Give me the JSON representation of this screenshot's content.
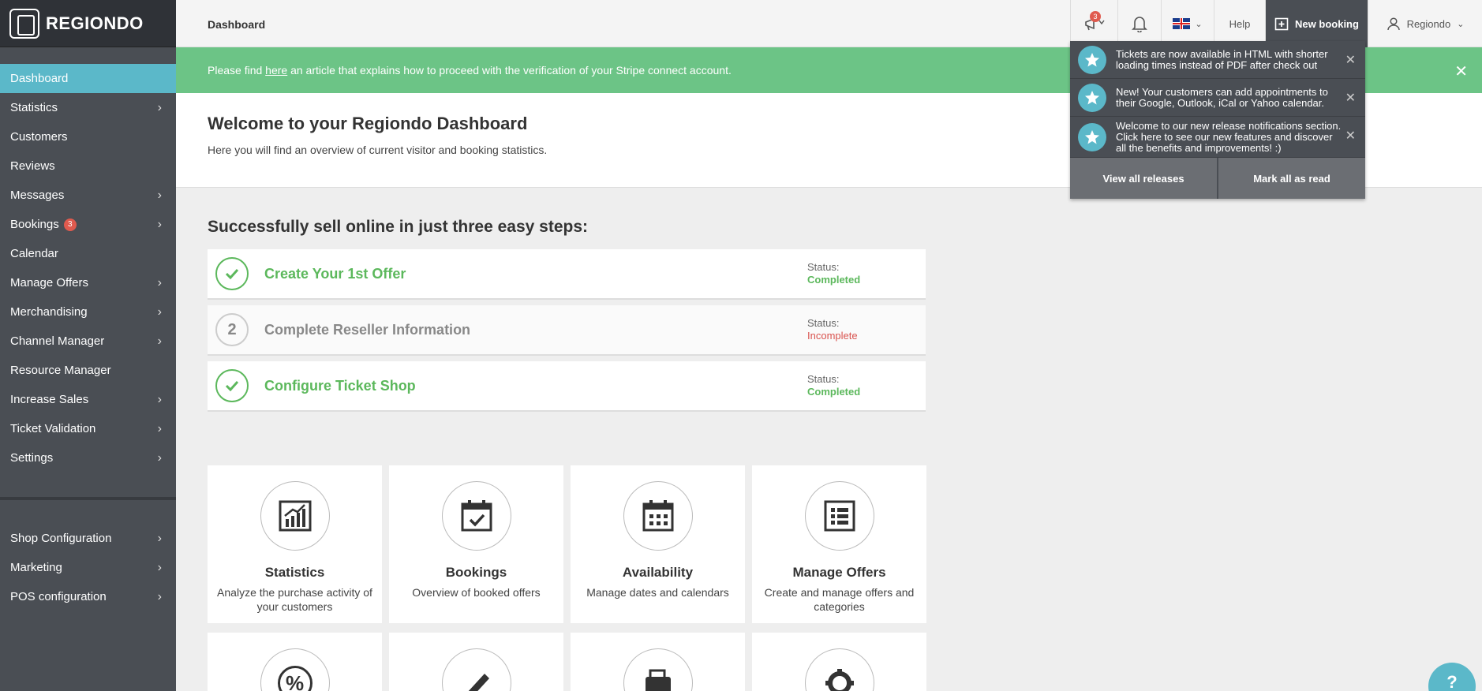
{
  "brand": {
    "name": "REGIONDO"
  },
  "sidebar": {
    "items": [
      {
        "label": "Dashboard",
        "icon": "none"
      },
      {
        "label": "Statistics",
        "icon": "chevron-right-icon"
      },
      {
        "label": "Customers",
        "icon": "none"
      },
      {
        "label": "Reviews",
        "icon": "none"
      },
      {
        "label": "Messages",
        "icon": "chevron-right-icon"
      },
      {
        "label": "Bookings",
        "badge": "3",
        "icon": "chevron-right-icon"
      },
      {
        "label": "Calendar",
        "icon": "none"
      },
      {
        "label": "Manage Offers",
        "icon": "chevron-right-icon"
      },
      {
        "label": "Merchandising",
        "icon": "chevron-right-icon"
      },
      {
        "label": "Channel Manager",
        "icon": "chevron-right-icon"
      },
      {
        "label": "Resource Manager",
        "icon": "none"
      },
      {
        "label": "Increase Sales",
        "icon": "chevron-right-icon"
      },
      {
        "label": "Ticket Validation",
        "icon": "chevron-right-icon"
      },
      {
        "label": "Settings",
        "icon": "chevron-right-icon"
      }
    ],
    "secondary": [
      {
        "label": "Shop Configuration",
        "icon": "chevron-right-icon"
      },
      {
        "label": "Marketing",
        "icon": "chevron-right-icon"
      },
      {
        "label": "POS configuration",
        "icon": "chevron-right-icon"
      }
    ]
  },
  "topbar": {
    "title": "Dashboard",
    "release_badge": "3",
    "help": "Help",
    "new_booking": "New booking",
    "user": "Regiondo"
  },
  "banner": {
    "text_before": "Please find ",
    "link": "here",
    "text_after": " an article that explains how to proceed with the verification of your Stripe connect account."
  },
  "welcome": {
    "title": "Welcome to your Regiondo Dashboard",
    "subtitle": "Here you will find an overview of current visitor and booking statistics."
  },
  "steps": {
    "heading": "Successfully sell online in just three easy steps:",
    "items": [
      {
        "number": "",
        "title": "Create Your 1st Offer",
        "status_label": "Status:",
        "status": "Completed",
        "state": "complete"
      },
      {
        "number": "2",
        "title": "Complete Reseller Information",
        "status_label": "Status:",
        "status": "Incomplete",
        "state": "incomplete"
      },
      {
        "number": "",
        "title": "Configure Ticket Shop",
        "status_label": "Status:",
        "status": "Completed",
        "state": "complete"
      }
    ]
  },
  "cards": [
    {
      "title": "Statistics",
      "desc": "Analyze the purchase activity of your customers",
      "icon": "chart-icon"
    },
    {
      "title": "Bookings",
      "desc": "Overview of booked offers",
      "icon": "calendar-check-icon"
    },
    {
      "title": "Availability",
      "desc": "Manage dates and calendars",
      "icon": "calendar-grid-icon"
    },
    {
      "title": "Manage Offers",
      "desc": "Create and manage offers and categories",
      "icon": "list-icon"
    }
  ],
  "cards_partial_icons": [
    "percent-icon",
    "ticket-icon",
    "wallet-icon",
    "gear-icon"
  ],
  "notifications": {
    "items": [
      {
        "text": "Tickets are now available in HTML with shorter loading times instead of PDF after check out"
      },
      {
        "text": "New! Your customers can add appointments to their Google, Outlook, iCal or Yahoo calendar."
      },
      {
        "text": "Welcome to our new release notifications section. Click here to see our new features and discover all the benefits and improvements! :)"
      }
    ],
    "view_all": "View all releases",
    "mark_all": "Mark all as read"
  },
  "help_bubble": "?",
  "colors": {
    "sidebar": "#4a4e54",
    "active": "#5bb8c9",
    "success": "#5cb85c",
    "banner": "#6cc486",
    "danger": "#d9534f"
  }
}
